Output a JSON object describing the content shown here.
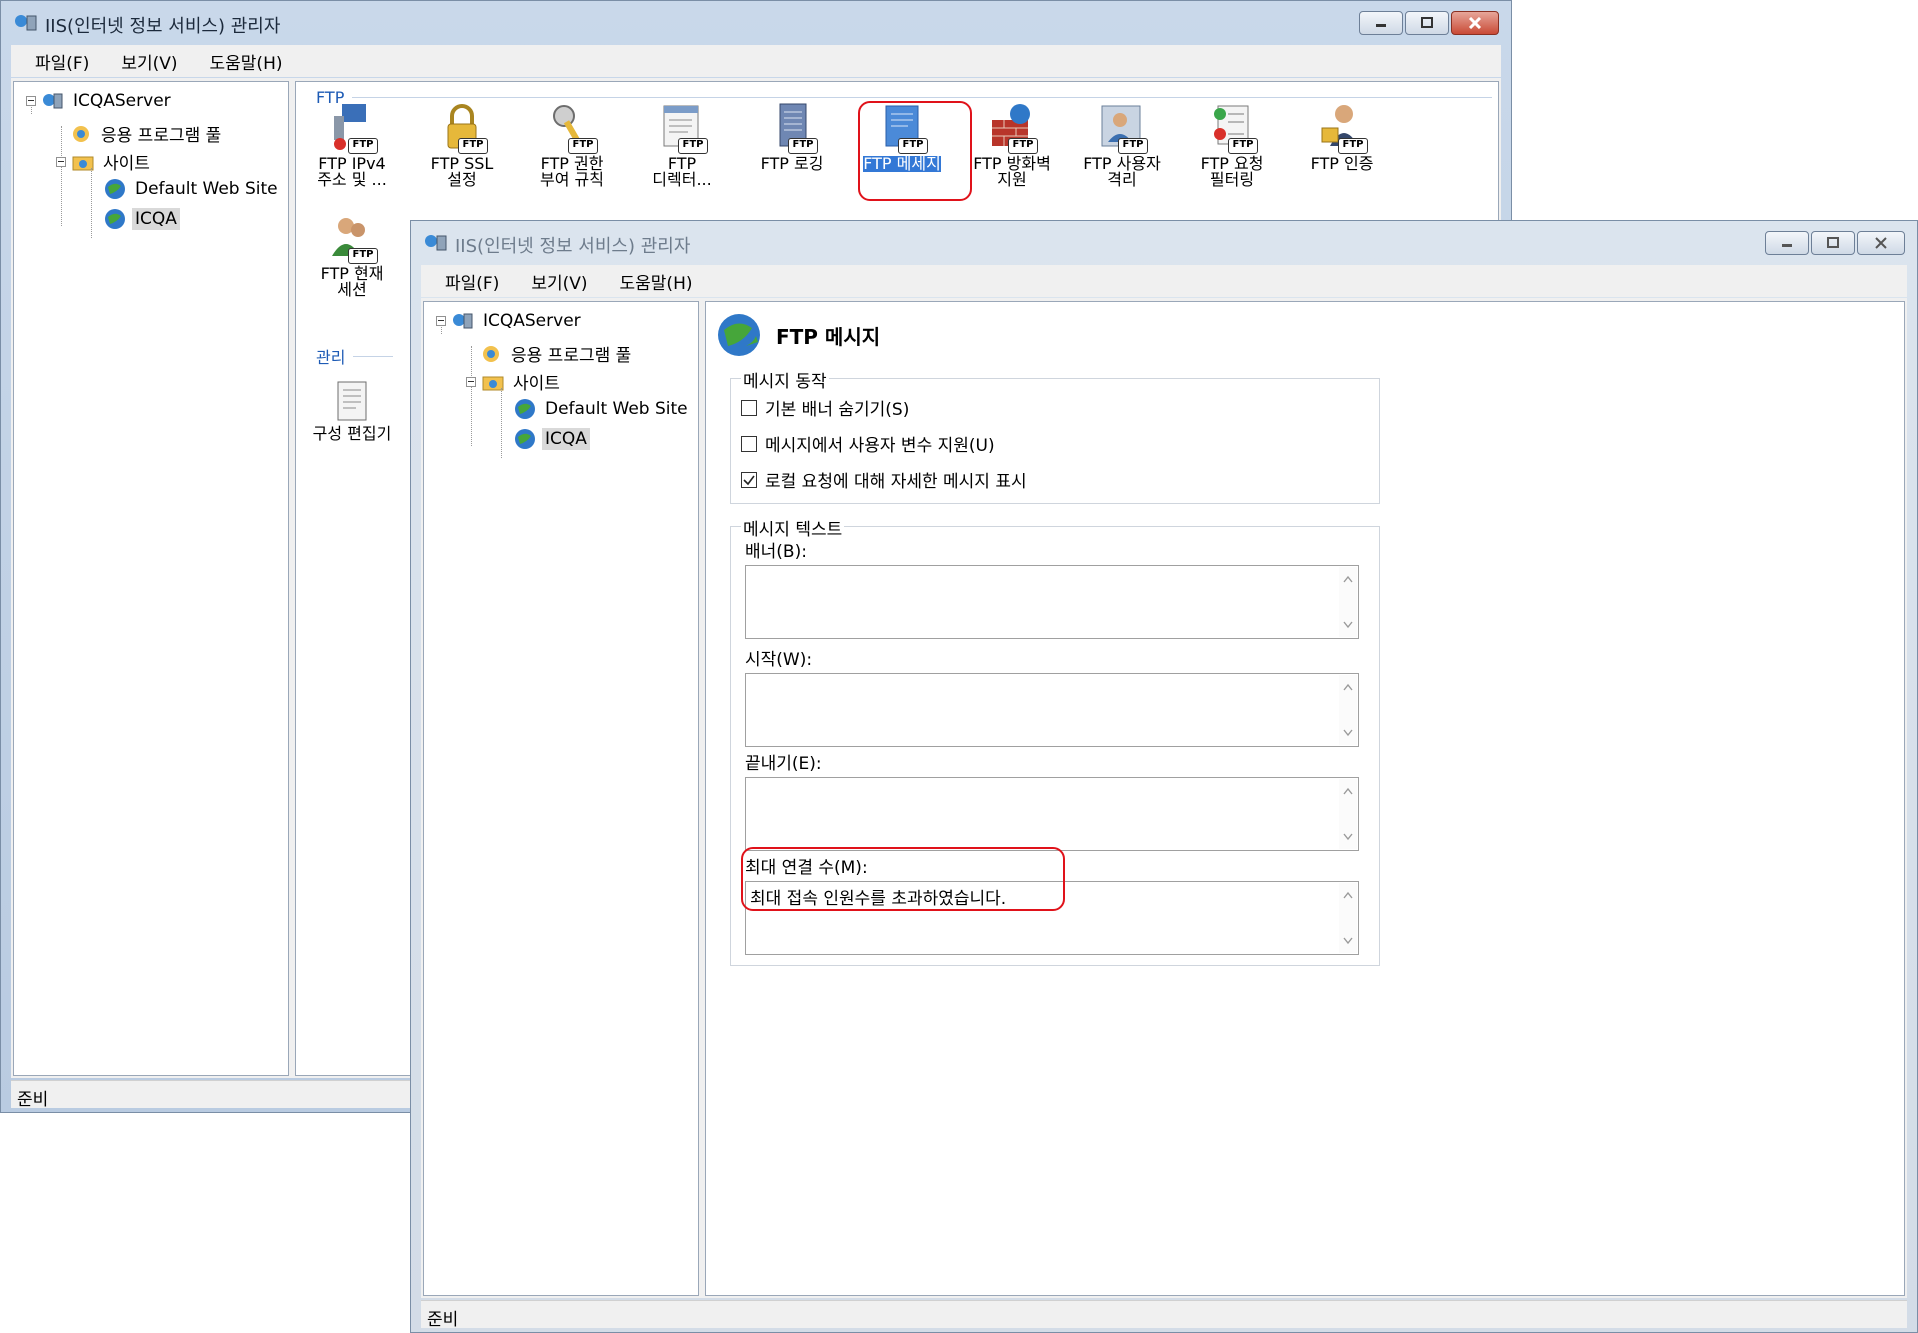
{
  "app_title": "IIS(인터넷 정보 서비스) 관리자",
  "menu": {
    "file": "파일(F)",
    "view": "보기(V)",
    "help": "도움말(H)"
  },
  "tree": {
    "server": "ICQAServer",
    "app_pool": "응용 프로그램 풀",
    "sites": "사이트",
    "default_site": "Default Web Site",
    "icqa": "ICQA"
  },
  "back": {
    "section_ftp": "FTP",
    "section_manage": "관리",
    "features": [
      {
        "l1": "FTP IPv4",
        "l2": "주소 및 ..."
      },
      {
        "l1": "FTP SSL",
        "l2": "설정"
      },
      {
        "l1": "FTP 권한",
        "l2": "부여 규칙"
      },
      {
        "l1": "FTP",
        "l2": "디렉터..."
      },
      {
        "l1": "FTP 로깅",
        "l2": ""
      },
      {
        "l1": "FTP 메세지",
        "l2": ""
      },
      {
        "l1": "FTP 방화벽",
        "l2": "지원"
      },
      {
        "l1": "FTP 사용자",
        "l2": "격리"
      },
      {
        "l1": "FTP 요청",
        "l2": "필터링"
      },
      {
        "l1": "FTP 인증",
        "l2": ""
      },
      {
        "l1": "FTP 현재",
        "l2": "세션"
      }
    ],
    "config_editor": "구성 편집기",
    "badge": "FTP"
  },
  "page": {
    "title": "FTP 메시지",
    "behavior_group": "메시지 동작",
    "checkboxes": [
      {
        "label": "기본 배너 숨기기(S)",
        "checked": false
      },
      {
        "label": "메시지에서 사용자 변수 지원(U)",
        "checked": false
      },
      {
        "label": "로컬 요청에 대해 자세한 메시지 표시",
        "checked": true
      }
    ],
    "text_group": "메시지 텍스트",
    "banner_label": "배너(B):",
    "banner_value": "",
    "welcome_label": "시작(W):",
    "welcome_value": "",
    "exit_label": "끝내기(E):",
    "exit_value": "",
    "maxconn_label": "최대 연결 수(M):",
    "maxconn_value": "최대 접속 인원수를 초과하였습니다."
  },
  "status": "준비",
  "colors": {
    "accent": "#3378d6",
    "highlight": "#e0121a"
  }
}
